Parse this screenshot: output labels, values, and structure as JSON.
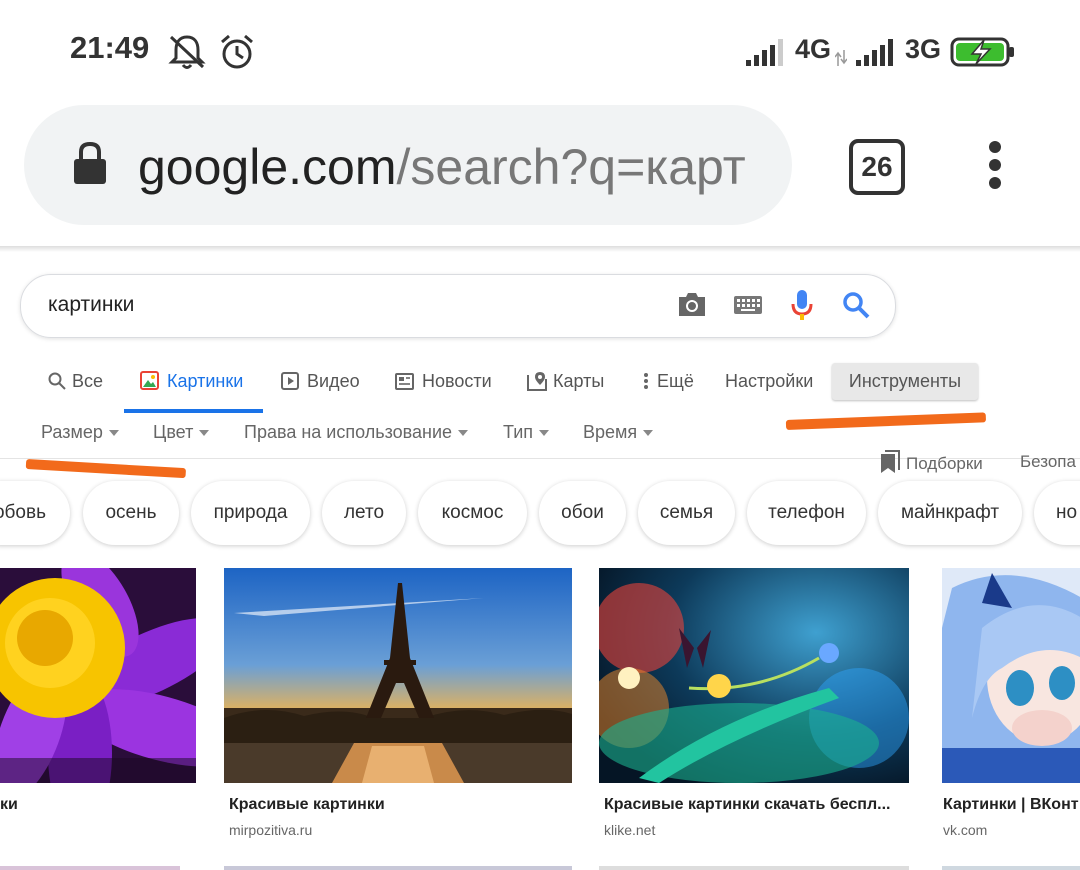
{
  "status_bar": {
    "time": "21:49",
    "network_1": "4G",
    "network_2": "3G",
    "icons": [
      "mute-icon",
      "alarm-icon",
      "signal-icon",
      "battery-charging-icon"
    ]
  },
  "browser": {
    "url_host": "google.com",
    "url_path": "/search?q=карт",
    "tab_count": "26"
  },
  "search": {
    "query": "картинки"
  },
  "tabs": [
    {
      "label": "Все",
      "icon": "search-icon"
    },
    {
      "label": "Картинки",
      "icon": "image-icon",
      "active": true
    },
    {
      "label": "Видео",
      "icon": "video-icon"
    },
    {
      "label": "Новости",
      "icon": "news-icon"
    },
    {
      "label": "Карты",
      "icon": "map-icon"
    },
    {
      "label": "Ещё",
      "icon": "more-icon"
    },
    {
      "label": "Настройки"
    },
    {
      "label": "Инструменты"
    }
  ],
  "filters": [
    "Размер",
    "Цвет",
    "Права на использование",
    "Тип",
    "Время"
  ],
  "extras": {
    "collections": "Подборки",
    "safe": "Безопа"
  },
  "chips": [
    "обовь",
    "осень",
    "природа",
    "лето",
    "космос",
    "обои",
    "семья",
    "телефон",
    "майнкрафт",
    "но"
  ],
  "results": [
    {
      "title": "ки",
      "domain": ""
    },
    {
      "title": "Красивые картинки",
      "domain": "mirpozitiva.ru"
    },
    {
      "title": "Красивые картинки скачать беспл...",
      "domain": "klike.net"
    },
    {
      "title": "Картинки | ВКонт",
      "domain": "vk.com"
    }
  ],
  "colors": {
    "accent": "#1a73e8",
    "annotation": "#f26a1b"
  }
}
